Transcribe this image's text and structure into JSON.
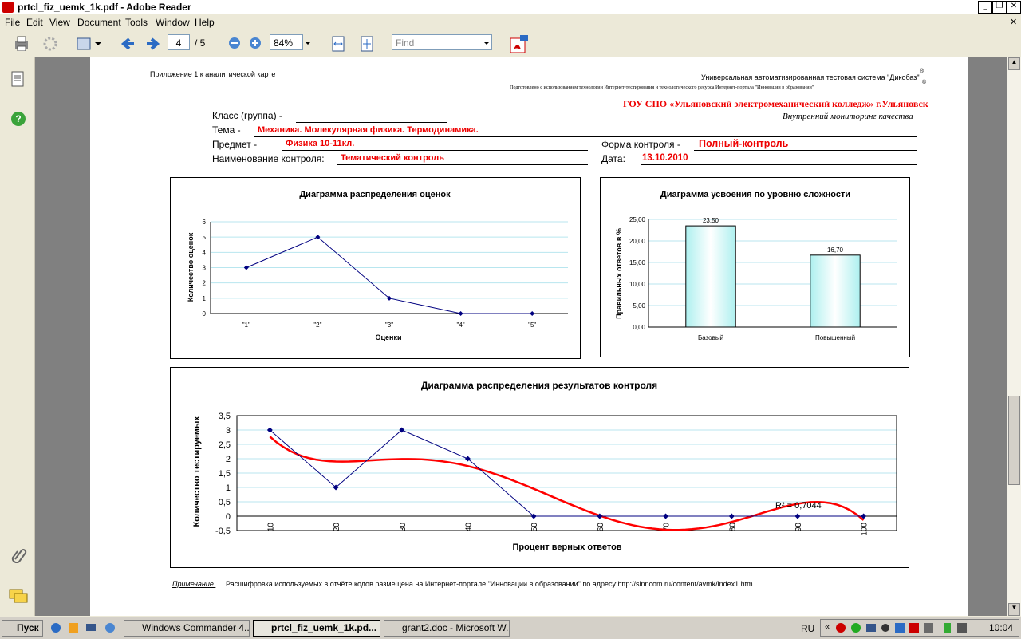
{
  "window": {
    "title": "prtcl_fiz_uemk_1k.pdf - Adobe Reader"
  },
  "menu": [
    "File",
    "Edit",
    "View",
    "Document",
    "Tools",
    "Window",
    "Help"
  ],
  "toolbar": {
    "page_current": "4",
    "page_total": "/ 5",
    "zoom": "84%",
    "find_placeholder": "Find"
  },
  "doc": {
    "appendix": "Приложение 1 к аналитической карте",
    "system_line": "Универсальная автоматизированная тестовая система \"Дикобаз\"",
    "prepared_line": "Подготовлено с использованием технологии Интернет-тестирования и технологического ресурса  Интернет-портала \"Инновации в образовании\"",
    "org": "ГОУ СПО «Ульяновский электромеханический колледж» г.Ульяновск",
    "monitoring": "Внутренний мониторинг  качества",
    "class_label": "Класс (группа) -",
    "topic_label": "Тема -",
    "topic_value": "Механика. Молекулярная физика. Термодинамика.",
    "subject_label": "Предмет  -",
    "subject_value": "Физика 10-11кл.",
    "form_label": "Форма контроля -",
    "form_value": "Полный-контроль",
    "control_label": "Наименование контроля:",
    "control_value": "Тематический контроль",
    "date_label": "Дата:",
    "date_value": "13.10.2010",
    "note_label": "Примечание:",
    "note_text": "Расшифровка используемых в отчёте кодов размещена на Интернет-портале \"Инновации в образовании\" по адресу:http://sinncom.ru/content/avmk/index1.htm"
  },
  "chart_data": [
    {
      "type": "line",
      "title": "Диаграмма распределения оценок",
      "xlabel": "Оценки",
      "ylabel": "Количество оценок",
      "categories": [
        "\"1\"",
        "\"2\"",
        "\"3\"",
        "\"4\"",
        "\"5\""
      ],
      "values": [
        3,
        5,
        1,
        0,
        0
      ],
      "ylim": [
        0,
        6
      ],
      "yticks": [
        "0",
        "1",
        "2",
        "3",
        "4",
        "5",
        "6"
      ],
      "grid": true,
      "color": "#000080"
    },
    {
      "type": "bar",
      "title": "Диаграмма усвоения по уровню сложности",
      "xlabel": "",
      "ylabel": "Правильных ответов в %",
      "categories": [
        "Базовый",
        "Повышенный"
      ],
      "values": [
        23.5,
        16.7
      ],
      "value_labels": [
        "23,50",
        "16,70"
      ],
      "ylim": [
        0,
        25
      ],
      "yticks": [
        "0,00",
        "5,00",
        "10,00",
        "15,00",
        "20,00",
        "25,00"
      ],
      "grid": true
    },
    {
      "type": "line",
      "title": "Диаграмма распределения результатов контроля",
      "xlabel": "Процент верных ответов",
      "ylabel": "Количество тестируемых",
      "categories": [
        "10",
        "20",
        "30",
        "40",
        "50",
        "60",
        "70",
        "80",
        "90",
        "100"
      ],
      "values": [
        3,
        1,
        3,
        2,
        0,
        0,
        0,
        0,
        0,
        0
      ],
      "ylim": [
        -0.5,
        3.5
      ],
      "yticks": [
        "-0,5",
        "0",
        "0,5",
        "1",
        "1,5",
        "2",
        "2,5",
        "3",
        "3,5"
      ],
      "trendline": {
        "type": "polynomial",
        "r2_label": "R² = 0,7044",
        "color": "#ff0000"
      },
      "grid": true,
      "color": "#000080"
    }
  ],
  "taskbar": {
    "start": "Пуск",
    "tasks": [
      "Windows Commander 4....",
      "prtcl_fiz_uemk_1k.pd...",
      "grant2.doc - Microsoft W..."
    ],
    "lang": "RU",
    "clock": "10:04"
  }
}
